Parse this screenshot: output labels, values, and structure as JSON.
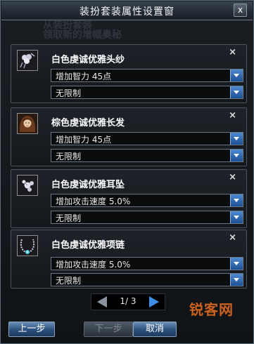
{
  "window": {
    "title": "装扮套装属性设置窗",
    "close_glyph": "x"
  },
  "background_text": {
    "line1": "从装扮套装",
    "line2": "领取新的增幅奥秘"
  },
  "items": [
    {
      "name": "白色虔诚优雅头纱",
      "icon": "veil-icon",
      "attribute": "增加智力 45点",
      "restriction": "无限制",
      "remove_glyph": "×"
    },
    {
      "name": "棕色虔诚优雅长发",
      "icon": "hair-portrait-icon",
      "attribute": "增加智力 45点",
      "restriction": "无限制",
      "remove_glyph": "×"
    },
    {
      "name": "白色虔诚优雅耳坠",
      "icon": "earring-icon",
      "attribute": "增加攻击速度 5.0%",
      "restriction": "无限制",
      "remove_glyph": "×"
    },
    {
      "name": "白色虔诚优雅项链",
      "icon": "necklace-icon",
      "attribute": "增加攻击速度 5.0%",
      "restriction": "无限制",
      "remove_glyph": "×"
    }
  ],
  "pager": {
    "text": "1/ 3",
    "current": 1,
    "total": 3
  },
  "buttons": {
    "prev": "上一步",
    "next": "下一步",
    "cancel": "取消"
  },
  "watermark": "锐客网",
  "colors": {
    "accent_blue": "#3c8de6",
    "watermark_orange": "#e06a20"
  }
}
